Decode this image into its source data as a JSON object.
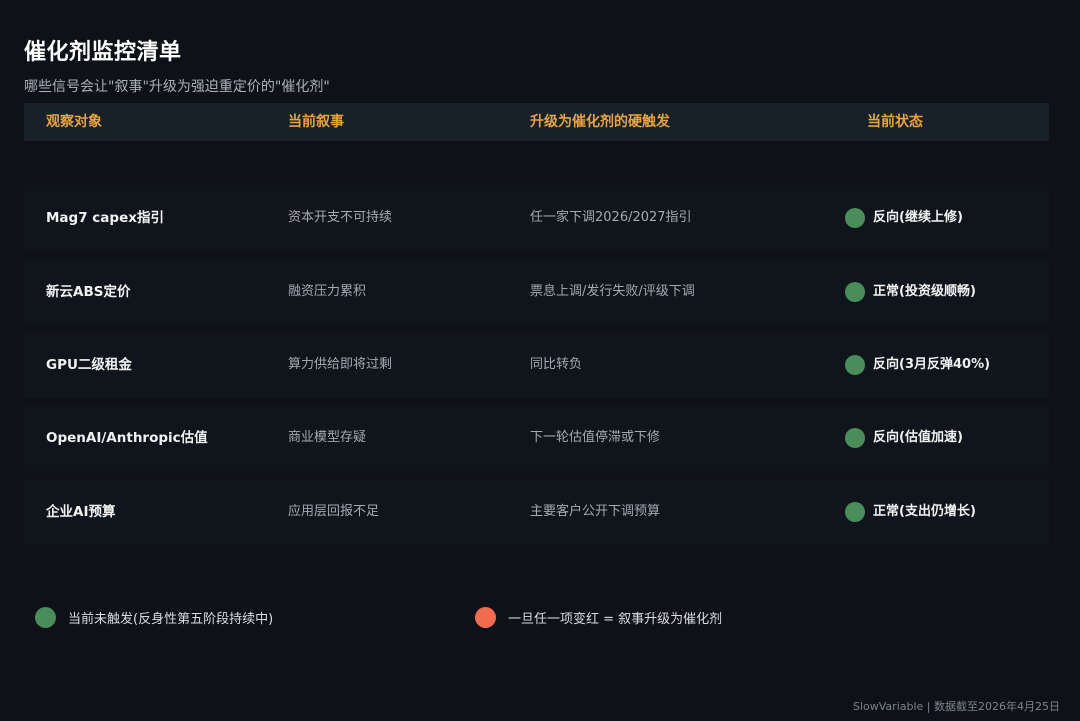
{
  "title": "催化剂监控清单",
  "subtitle": "哪些信号会让\"叙事\"升级为强迫重定价的\"催化剂\"",
  "columns": [
    "观察对象",
    "当前叙事",
    "升级为催化剂的硬触发",
    "当前状态"
  ],
  "rows": [
    {
      "target": "Mag7 capex指引",
      "narrative": "资本开支不可持续",
      "trigger": "任一家下调2026/2027指引",
      "status": "反向(继续上修)"
    },
    {
      "target": "新云ABS定价",
      "narrative": "融资压力累积",
      "trigger": "票息上调/发行失败/评级下调",
      "status": "正常(投资级顺畅)"
    },
    {
      "target": "GPU二级租金",
      "narrative": "算力供给即将过剩",
      "trigger": "同比转负",
      "status": "反向(3月反弹40%)"
    },
    {
      "target": "OpenAI/Anthropic估值",
      "narrative": "商业模型存疑",
      "trigger": "下一轮估值停滞或下修",
      "status": "反向(估值加速)"
    },
    {
      "target": "企业AI预算",
      "narrative": "应用层回报不足",
      "trigger": "主要客户公开下调预算",
      "status": "正常(支出仍增长)"
    }
  ],
  "colors": {
    "status_green": "#4a8c5a",
    "alert_red": "#f26d4f",
    "header_accent": "#e8a33d"
  },
  "legend": {
    "green_label": "当前未触发(反身性第五阶段持续中)",
    "red_label": "一旦任一项变红 = 叙事升级为催化剂"
  },
  "footer": "SlowVariable | 数据截至2026年4月25日"
}
